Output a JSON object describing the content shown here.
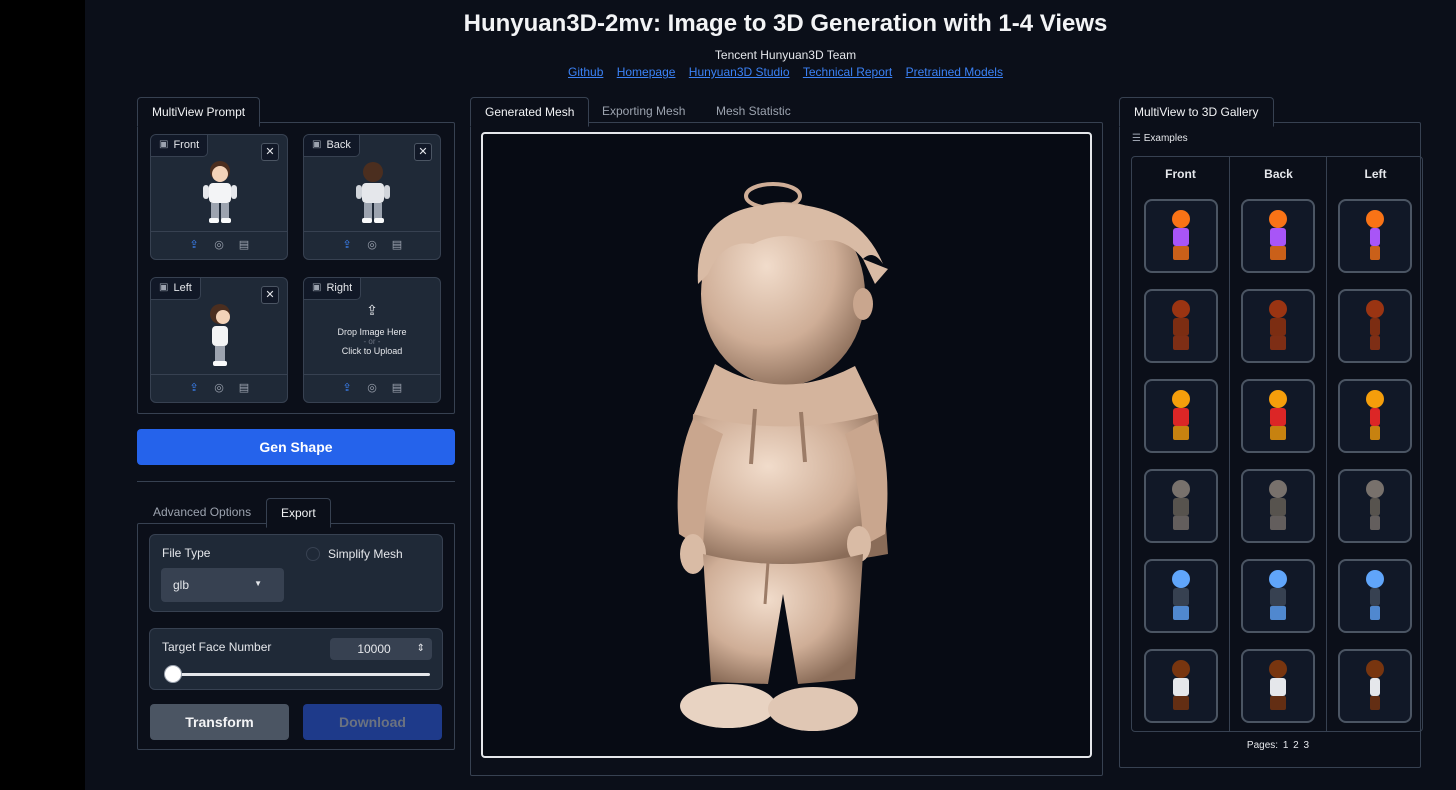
{
  "header": {
    "title": "Hunyuan3D-2mv: Image to 3D Generation with 1-4 Views",
    "team": "Tencent Hunyuan3D Team",
    "links": [
      "Github",
      "Homepage",
      "Hunyuan3D Studio",
      "Technical Report",
      "Pretrained Models"
    ]
  },
  "left": {
    "prompt_tab": "MultiView Prompt",
    "views": {
      "front": "Front",
      "back": "Back",
      "left": "Left",
      "right": "Right"
    },
    "dropzone": {
      "drop": "Drop Image Here",
      "or": "- or -",
      "click": "Click to Upload"
    },
    "gen_button": "Gen Shape",
    "options_tabs": [
      "Advanced Options",
      "Export"
    ],
    "export": {
      "file_type_label": "File Type",
      "file_type_value": "glb",
      "simplify_label": "Simplify Mesh",
      "target_face_label": "Target Face Number",
      "target_face_value": "10000",
      "slider_level": 0,
      "transform_button": "Transform",
      "download_button": "Download"
    }
  },
  "middle": {
    "tabs": [
      "Generated Mesh",
      "Exporting Mesh",
      "Mesh Statistic"
    ]
  },
  "right": {
    "tab": "MultiView to 3D Gallery",
    "examples_label": "Examples",
    "columns": [
      "Front",
      "Back",
      "Left"
    ],
    "rows": [
      {
        "color": "#f97316",
        "accent": "#a855f7"
      },
      {
        "color": "#9a3412",
        "accent": "#7c2d12"
      },
      {
        "color": "#f59e0b",
        "accent": "#dc2626"
      },
      {
        "color": "#78716c",
        "accent": "#57534e"
      },
      {
        "color": "#60a5fa",
        "accent": "#374151"
      },
      {
        "color": "#78350f",
        "accent": "#e5e7eb"
      }
    ],
    "pages_label": "Pages:",
    "pages": [
      "1",
      "2",
      "3"
    ]
  },
  "colors": {
    "accent": "#2563eb",
    "background": "#0b0f19",
    "panel": "#1f2937",
    "link": "#3b82f6"
  }
}
